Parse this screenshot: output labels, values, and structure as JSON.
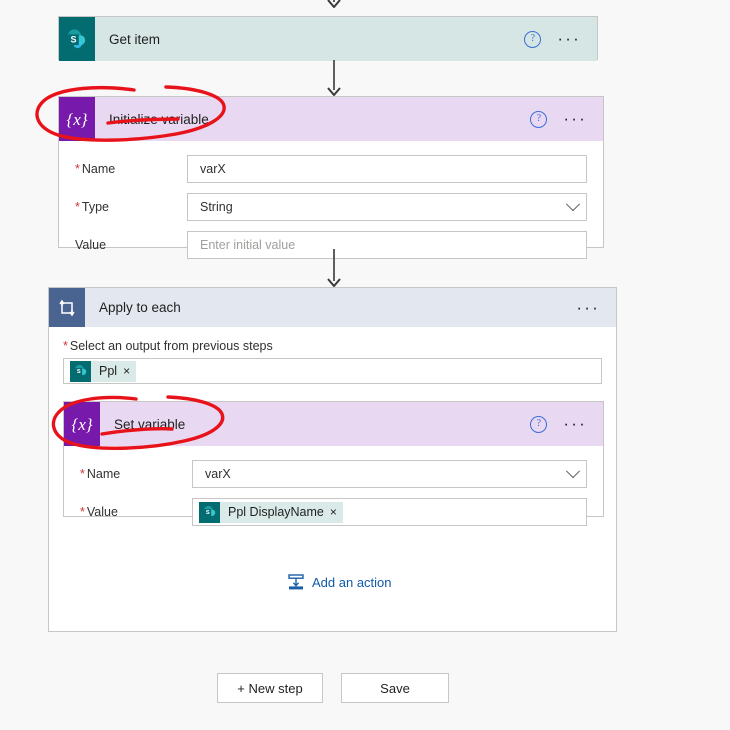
{
  "theme": {
    "page_bg": "#f8f8f8",
    "sharepoint_teal": "#036c70",
    "variable_purple": "#7719aa",
    "loop_blue": "#4a6491",
    "header_teal": "#d6e6e4",
    "header_purple": "#e8d8f2",
    "header_loop": "#e3e7ef",
    "link_blue": "#0f5ba7",
    "required_red": "#d13438",
    "annotation_red": "#e8131a"
  },
  "steps": {
    "get_item": {
      "title": "Get item",
      "icon": "sharepoint-icon",
      "help_label": "?",
      "menu_label": "···"
    },
    "initialize_variable": {
      "title": "Initialize variable",
      "icon": "variable-icon",
      "icon_glyph": "{x}",
      "help_label": "?",
      "menu_label": "···",
      "fields": [
        {
          "label": "Name",
          "required": true,
          "value": "varX",
          "placeholder": "",
          "control": "text"
        },
        {
          "label": "Type",
          "required": true,
          "value": "String",
          "placeholder": "",
          "control": "dropdown"
        },
        {
          "label": "Value",
          "required": false,
          "value": "",
          "placeholder": "Enter initial value",
          "control": "text"
        }
      ]
    },
    "apply_to_each": {
      "title": "Apply to each",
      "icon": "loop-icon",
      "menu_label": "···",
      "output_field": {
        "label": "Select an output from previous steps",
        "required": true,
        "token": {
          "text": "Ppl",
          "icon": "sharepoint-icon",
          "remove_label": "×"
        }
      },
      "add_action": {
        "label": "Add an action",
        "icon": "add-action-icon"
      }
    },
    "set_variable": {
      "title": "Set variable",
      "icon": "variable-icon",
      "icon_glyph": "{x}",
      "help_label": "?",
      "menu_label": "···",
      "fields": [
        {
          "label": "Name",
          "required": true,
          "value": "varX",
          "control": "dropdown"
        },
        {
          "label": "Value",
          "required": true,
          "control": "token",
          "token": {
            "text": "Ppl DisplayName",
            "icon": "sharepoint-icon",
            "remove_label": "×"
          }
        }
      ]
    }
  },
  "footer": {
    "new_step_label": "+ New step",
    "save_label": "Save"
  },
  "annotations": [
    {
      "name": "circle-initialize-variable",
      "target": "Initialize variable"
    },
    {
      "name": "circle-set-variable",
      "target": "Set variable"
    }
  ]
}
